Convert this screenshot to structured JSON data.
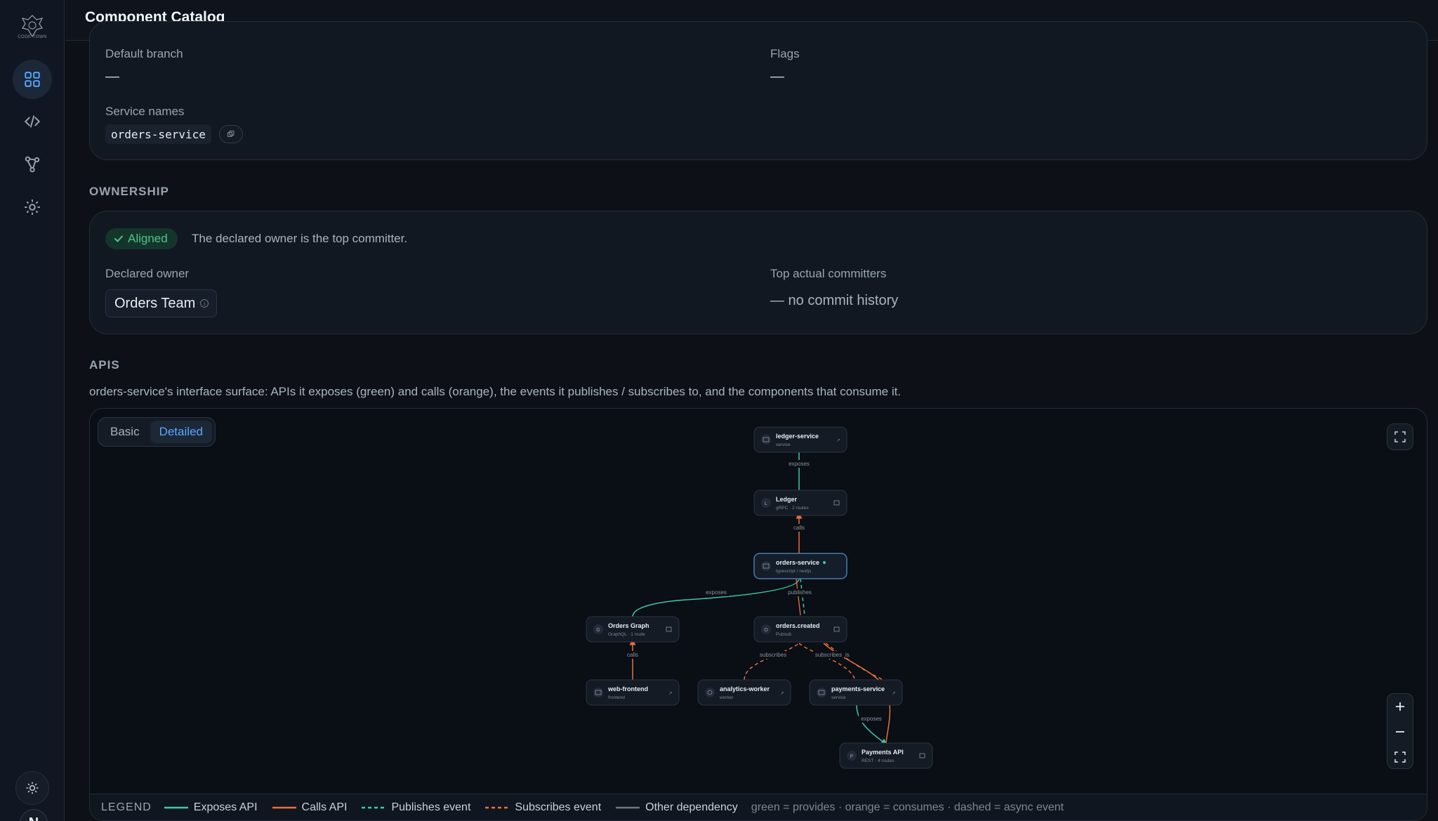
{
  "app": {
    "logo_text": "CODE TOWN",
    "title": "Component Catalog",
    "avatar_initial": "N"
  },
  "colors": {
    "exposes": "#3ec9a7",
    "calls": "#e8703a",
    "publishes": "#3ec9a7",
    "subscribes": "#e8703a",
    "other": "#8b949e",
    "accent": "#58a6ff",
    "aligned": "#4ec48f"
  },
  "details": {
    "default_branch_label": "Default branch",
    "default_branch_value": "—",
    "flags_label": "Flags",
    "flags_value": "—",
    "service_names_label": "Service names",
    "service_names": [
      "orders-service"
    ]
  },
  "ownership": {
    "title": "OWNERSHIP",
    "status": "Aligned",
    "status_text": "The declared owner is the top committer.",
    "declared_owner_label": "Declared owner",
    "declared_owner": "Orders Team",
    "top_committers_label": "Top actual committers",
    "top_committers_value": "— no commit history"
  },
  "apis": {
    "title": "APIS",
    "description": "orders-service's interface surface: APIs it exposes (green) and calls (orange), the events it publishes / subscribes to, and the components that consume it.",
    "view_options": [
      "Basic",
      "Detailed"
    ],
    "selected_view": "Detailed"
  },
  "graph": {
    "nodes": [
      {
        "id": "ledger-service",
        "title": "ledger-service",
        "subtitle": "service",
        "icon": "server-icon",
        "action": "open-link-icon"
      },
      {
        "id": "ledger",
        "title": "Ledger",
        "subtitle": "gRPC · 2 routes",
        "icon_letter": "L",
        "action": "details-icon"
      },
      {
        "id": "orders-service",
        "title": "orders-service",
        "subtitle": "typescript / nextjs",
        "icon": "server-icon",
        "focus": true
      },
      {
        "id": "orders-graph",
        "title": "Orders Graph",
        "subtitle": "GraphQL · 1 route",
        "icon_letter": "G",
        "action": "details-icon"
      },
      {
        "id": "orders-created",
        "title": "orders.created",
        "subtitle": "Pubsub",
        "icon_letter": "O",
        "action": "details-icon"
      },
      {
        "id": "web-frontend",
        "title": "web-frontend",
        "subtitle": "frontend",
        "icon": "browser-icon",
        "action": "open-link-icon"
      },
      {
        "id": "analytics-worker",
        "title": "analytics-worker",
        "subtitle": "worker",
        "icon": "gear-icon",
        "action": "open-link-icon"
      },
      {
        "id": "payments-service",
        "title": "payments-service",
        "subtitle": "service",
        "icon": "server-icon",
        "action": "open-link-icon"
      },
      {
        "id": "payments-api",
        "title": "Payments API",
        "subtitle": "REST · 4 routes",
        "icon_letter": "P",
        "action": "details-icon"
      }
    ],
    "edge_labels": {
      "ledger_exposes": "exposes",
      "ledger_calls": "calls",
      "graph_exposes": "exposes",
      "publishes": "publishes",
      "graph_calls": "calls",
      "subscribes_1": "subscribes",
      "subscribes_2": "subscribes",
      "subscribes_3": "is",
      "payments_exposes": "exposes"
    }
  },
  "legend": {
    "title": "LEGEND",
    "items": [
      {
        "label": "Exposes API",
        "style": "solid-green"
      },
      {
        "label": "Calls API",
        "style": "solid-orange"
      },
      {
        "label": "Publishes event",
        "style": "dashed-green"
      },
      {
        "label": "Subscribes event",
        "style": "dashed-orange"
      },
      {
        "label": "Other dependency",
        "style": "solid-gray"
      }
    ],
    "note": "green = provides · orange = consumes · dashed = async event"
  }
}
